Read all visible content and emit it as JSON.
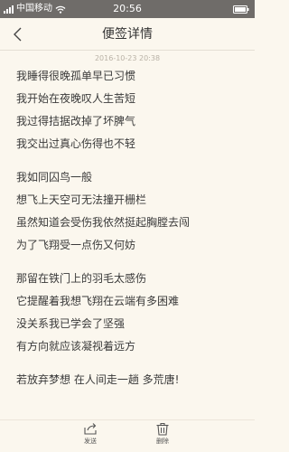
{
  "status_bar": {
    "carrier": "中国移动",
    "time": "20:56"
  },
  "header": {
    "title": "便签详情"
  },
  "note": {
    "date": "2016-10-23 20:38",
    "stanzas": [
      [
        "我睡得很晚孤单早已习惯",
        "我开始在夜晚叹人生苦短",
        "我过得拮据改掉了坏脾气",
        "我交出过真心伤得也不轻"
      ],
      [
        "我如同囚鸟一般",
        "想飞上天空可无法撞开栅栏",
        "虽然知道会受伤我依然挺起胸膛去闯",
        "为了飞翔受一点伤又何妨"
      ],
      [
        "那留在铁门上的羽毛太感伤",
        "它提醒着我想飞翔在云端有多困难",
        "没关系我已学会了坚强",
        "有方向就应该凝视着远方"
      ],
      [
        "若放弃梦想 在人间走一趟 多荒唐!"
      ]
    ]
  },
  "bottom_bar": {
    "send_label": "发送",
    "delete_label": "删除"
  },
  "icons": {
    "signal": "signal-icon",
    "wifi": "wifi-icon",
    "battery": "battery-icon",
    "back": "chevron-left-icon",
    "send": "share-icon",
    "delete": "trash-icon"
  }
}
